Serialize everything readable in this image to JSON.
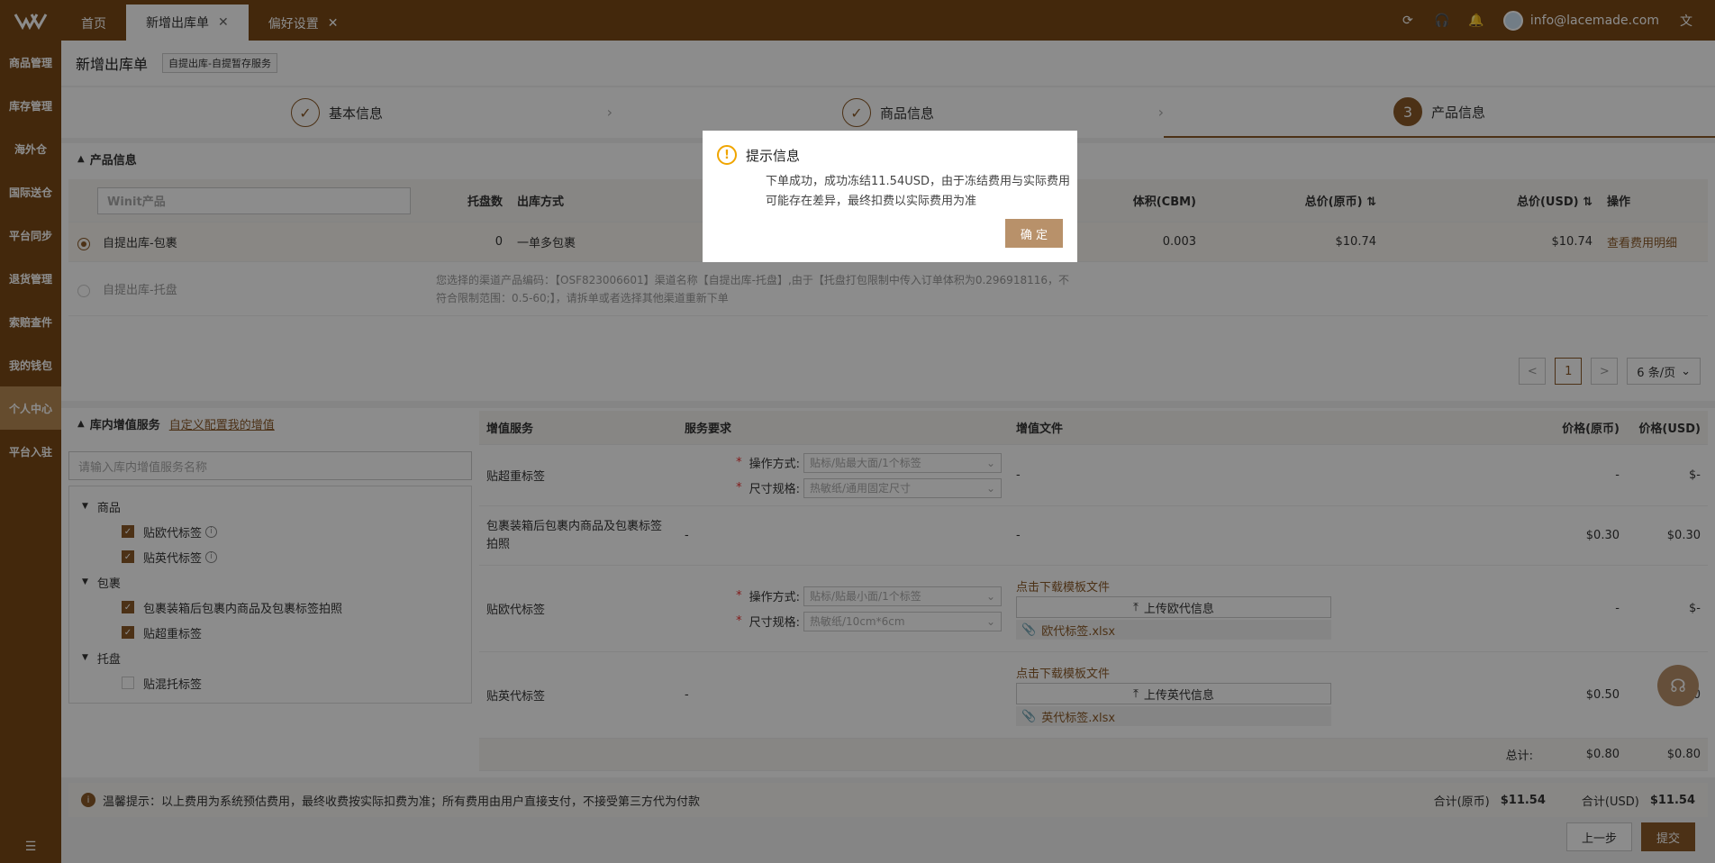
{
  "topbar": {
    "tabs": [
      {
        "label": "首页"
      },
      {
        "label": "新增出库单"
      },
      {
        "label": "偏好设置"
      }
    ],
    "user_email": "info@lacemade.com"
  },
  "sidebar": {
    "items": [
      "商品管理",
      "库存管理",
      "海外仓",
      "国际送仓",
      "平台同步",
      "退货管理",
      "索赔查件",
      "我的钱包",
      "个人中心",
      "平台入驻"
    ]
  },
  "page": {
    "title": "新增出库单",
    "tag": "自提出库-自提暂存服务"
  },
  "steps": [
    {
      "label": "基本信息",
      "mark": "✓"
    },
    {
      "label": "商品信息",
      "mark": "✓"
    },
    {
      "label": "产品信息",
      "mark": "3"
    }
  ],
  "product_section": {
    "title": "产品信息",
    "search_placeholder": "Winit产品",
    "headers": {
      "pallets": "托盘数",
      "method": "出库方式",
      "volume": "体积(CBM)",
      "total_orig": "总价(原币)",
      "total_usd": "总价(USD)",
      "ops": "操作"
    },
    "rows": [
      {
        "name": "自提出库-包裹",
        "pallets": "0",
        "method": "一单多包裹",
        "volume": "0.003",
        "total_orig": "$10.74",
        "total_usd": "$10.74",
        "op": "查看费用明细"
      },
      {
        "name": "自提出库-托盘",
        "msg1": "您选择的渠道产品编码：【OSF823006601】渠道名称【自提出库-托盘】,由于【托盘打包限制中传入订单体积为0.296918116，不",
        "msg2": "符合限制范围：0.5-60;】，请拆单或者选择其他渠道重新下单"
      }
    ],
    "pager": {
      "prev": "<",
      "page": "1",
      "next": ">",
      "size": "6 条/页"
    }
  },
  "vas_section": {
    "title": "库内增值服务",
    "config_link": "自定义配置我的增值",
    "search_placeholder": "请输入库内增值服务名称",
    "tree": [
      {
        "label": "商品",
        "level": 0
      },
      {
        "label": "贴欧代标签",
        "level": 1,
        "checked": true,
        "info": true
      },
      {
        "label": "贴英代标签",
        "level": 1,
        "checked": true,
        "info": true
      },
      {
        "label": "包裹",
        "level": 0
      },
      {
        "label": "包裹装箱后包裹内商品及包裹标签拍照",
        "level": 1,
        "checked": true
      },
      {
        "label": "贴超重标签",
        "level": 1,
        "checked": true
      },
      {
        "label": "托盘",
        "level": 0
      },
      {
        "label": "贴混托标签",
        "level": 1,
        "checked": false
      }
    ],
    "headers": {
      "service": "增值服务",
      "req": "服务要求",
      "file": "增值文件",
      "price_orig": "价格(原币)",
      "price_usd": "价格(USD)"
    },
    "rows": [
      {
        "service": "贴超重标签",
        "op_label": "操作方式:",
        "op_value": "贴标/贴最大面/1个标签",
        "size_label": "尺寸规格:",
        "size_value": "热敏纸/通用固定尺寸",
        "file": "-",
        "price_orig": "-",
        "price_usd": "$-"
      },
      {
        "service": "包裹装箱后包裹内商品及包裹标签拍照",
        "req": "-",
        "file": "-",
        "price_orig": "$0.30",
        "price_usd": "$0.30"
      },
      {
        "service": "贴欧代标签",
        "op_label": "操作方式:",
        "op_value": "贴标/贴最小面/1个标签",
        "size_label": "尺寸规格:",
        "size_value": "热敏纸/10cm*6cm",
        "download": "点击下载模板文件",
        "upload": "上传欧代信息",
        "filename": "欧代标签.xlsx",
        "price_orig": "-",
        "price_usd": "$-"
      },
      {
        "service": "贴英代标签",
        "req": "-",
        "download": "点击下载模板文件",
        "upload": "上传英代信息",
        "filename": "英代标签.xlsx",
        "price_orig": "$0.50",
        "price_usd": "$0.50"
      }
    ],
    "total_label": "总计:",
    "total_orig": "$0.80",
    "total_usd": "$0.80"
  },
  "footer": {
    "tip": "温馨提示：以上费用为系统预估费用，最终收费按实际扣费为准；所有费用由用户直接支付，不接受第三方代为付款",
    "sum_orig_label": "合计(原币)",
    "sum_orig": "$11.54",
    "sum_usd_label": "合计(USD)",
    "sum_usd": "$11.54",
    "prev_btn": "上一步",
    "submit_btn": "提交"
  },
  "modal": {
    "title": "提示信息",
    "body": "下单成功，成功冻结11.54USD，由于冻结费用与实际费用可能存在差异，最终扣费以实际费用为准",
    "ok": "确 定"
  },
  "colors": {
    "brand": "#7a4a17",
    "accent": "#8a5a28",
    "button": "#b8916a",
    "warn": "#f0a500"
  }
}
